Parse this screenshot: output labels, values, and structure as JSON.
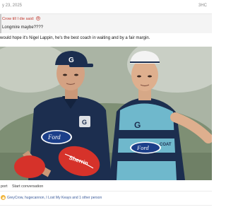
{
  "post": {
    "date": "y 23, 2025",
    "number": "3HC"
  },
  "quote": {
    "author": "Crow till I die said:",
    "text": "Longmire maybe????"
  },
  "message": {
    "text": "would hope it's Nigel Lappin, he's the best coach in waiting and by a fair margin."
  },
  "image": {
    "left_cap_logo": "G",
    "left_shirt_sponsor": "Ford",
    "left_shirt_badge": "G",
    "right_shirt_logo": "G",
    "right_shirt_sponsor": "Ford",
    "right_shirt_brand": "COAT",
    "ball_text": "Sherrin",
    "colors": {
      "navy": "#1c2e4f",
      "hoops_light": "#6fb8cc",
      "ball_red": "#d6322a"
    }
  },
  "actions": {
    "report": "port",
    "start_conversation": "Start conversation"
  },
  "reactions": {
    "text": "GreyCrow, hugecannon, I Lost My Keays and 1 other person"
  },
  "icons": {
    "quote_arrow": "quote-arrow-icon",
    "reaction": "thumbs-up-icon"
  }
}
